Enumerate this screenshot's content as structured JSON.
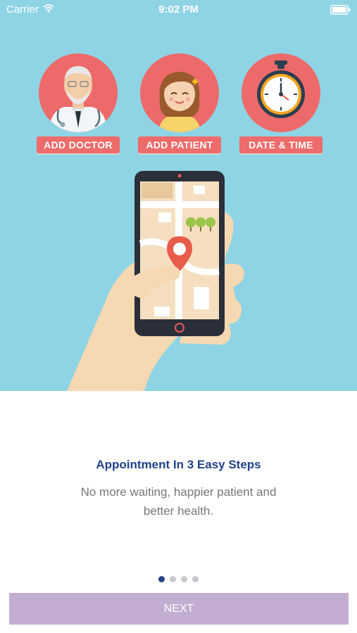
{
  "status_bar": {
    "carrier": "Carrier",
    "time": "9:02 PM",
    "wifi_icon": "wifi-icon",
    "battery_icon": "battery-icon"
  },
  "steps": [
    {
      "label": "ADD DOCTOR",
      "icon": "doctor-icon"
    },
    {
      "label": "ADD PATIENT",
      "icon": "patient-icon"
    },
    {
      "label": "DATE & TIME",
      "icon": "stopwatch-icon"
    }
  ],
  "illustration": {
    "icon": "phone-map-icon"
  },
  "onboarding": {
    "title": "Appointment In 3 Easy Steps",
    "subtitle": "No more waiting, happier patient and better health.",
    "page_count": 4,
    "current_page": 1
  },
  "next_button": {
    "label": "NEXT"
  },
  "colors": {
    "hero_background": "#8fd4e4",
    "step_badge": "#ed6a6a",
    "title": "#22428a",
    "next_button": "#c3aed1",
    "dot_active": "#22428a",
    "dot_inactive": "#c9c9cf"
  }
}
